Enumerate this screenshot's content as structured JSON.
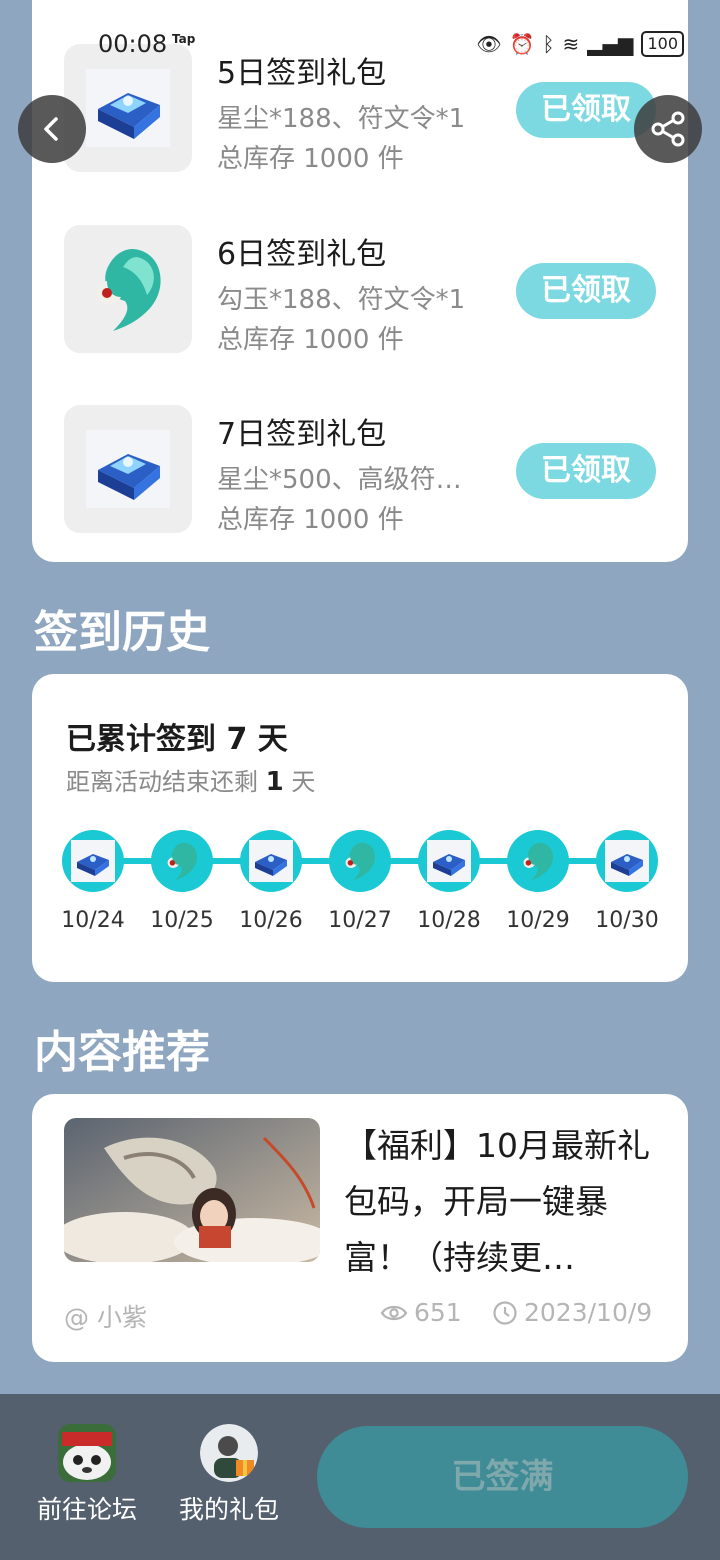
{
  "status_bar": {
    "time": "00:08",
    "tap_label": "Tap",
    "battery": "100"
  },
  "gifts": [
    {
      "title": "5日签到礼包",
      "desc": "星尘*188、符文令*1",
      "stock": "总库存 1000 件",
      "button": "已领取",
      "icon": "blue-chest-icon"
    },
    {
      "title": "6日签到礼包",
      "desc": "勾玉*188、符文令*1",
      "stock": "总库存 1000 件",
      "button": "已领取",
      "icon": "jade-magatama-icon"
    },
    {
      "title": "7日签到礼包",
      "desc": "星尘*500、高级符…",
      "stock": "总库存 1000 件",
      "button": "已领取",
      "icon": "blue-chest-icon"
    }
  ],
  "history": {
    "section_title": "签到历史",
    "total_prefix": "已累计签到",
    "total_days": "7",
    "total_suffix": "天",
    "remain_prefix": "距离活动结束还剩",
    "remain_days": "1",
    "remain_suffix": "天",
    "dates": [
      "10/24",
      "10/25",
      "10/26",
      "10/27",
      "10/28",
      "10/29",
      "10/30"
    ]
  },
  "recommend": {
    "section_title": "内容推荐",
    "article_title": "【福利】10月最新礼包码，开局一键暴富！（持续更…",
    "author": "@ 小紫",
    "views": "651",
    "date": "2023/10/9"
  },
  "bottom_bar": {
    "forum_label": "前往论坛",
    "gifts_label": "我的礼包",
    "signed_full_label": "已签满"
  },
  "colors": {
    "background": "#8fa6c0",
    "accent": "#1bc9d4",
    "claimed_button": "#7dd9e1",
    "bottom_bar": "#55606e",
    "full_button": "#3f8c97"
  }
}
